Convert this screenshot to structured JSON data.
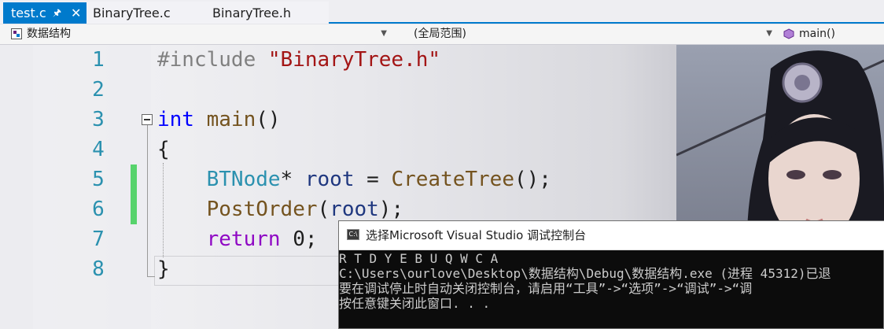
{
  "tabs": [
    {
      "label": "test.c",
      "active": true
    },
    {
      "label": "BinaryTree.c",
      "active": false
    },
    {
      "label": "BinaryTree.h",
      "active": false
    }
  ],
  "tab_icons": {
    "pin": "pin-icon",
    "close": "close-icon"
  },
  "navbar": {
    "project": "数据结构",
    "scope": "(全局范围)",
    "member": "main()"
  },
  "editor": {
    "line_numbers": [
      "1",
      "2",
      "3",
      "4",
      "5",
      "6",
      "7",
      "8"
    ],
    "lines": {
      "l1_pp": "#include ",
      "l1_str": "\"BinaryTree.h\"",
      "l3_kw": "int",
      "l3_fn": "main",
      "l3_rest": "()",
      "l4": "{",
      "l5_type": "BTNode",
      "l5_star": "* ",
      "l5_var": "root",
      "l5_eq": " = ",
      "l5_fn": "CreateTree",
      "l5_end": "();",
      "l6_fn": "PostOrder",
      "l6_open": "(",
      "l6_var": "root",
      "l6_end": ");",
      "l7_kw": "return",
      "l7_rest": " 0;",
      "l8": "}"
    },
    "changed_lines": [
      5,
      6
    ]
  },
  "console": {
    "title": "选择Microsoft Visual Studio 调试控制台",
    "output": [
      "R T D Y E B U Q W C A",
      "C:\\Users\\ourlove\\Desktop\\数据结构\\Debug\\数据结构.exe (进程 45312)已退",
      "要在调试停止时自动关闭控制台，请启用“工具”->“选项”->“调试”->“调",
      "按任意键关闭此窗口. . ."
    ]
  },
  "colors": {
    "accent": "#007acc",
    "line_number": "#2b91af",
    "keyword": "#0000ff",
    "string": "#a31515",
    "function": "#74531f",
    "change_bar": "#57d36c"
  }
}
